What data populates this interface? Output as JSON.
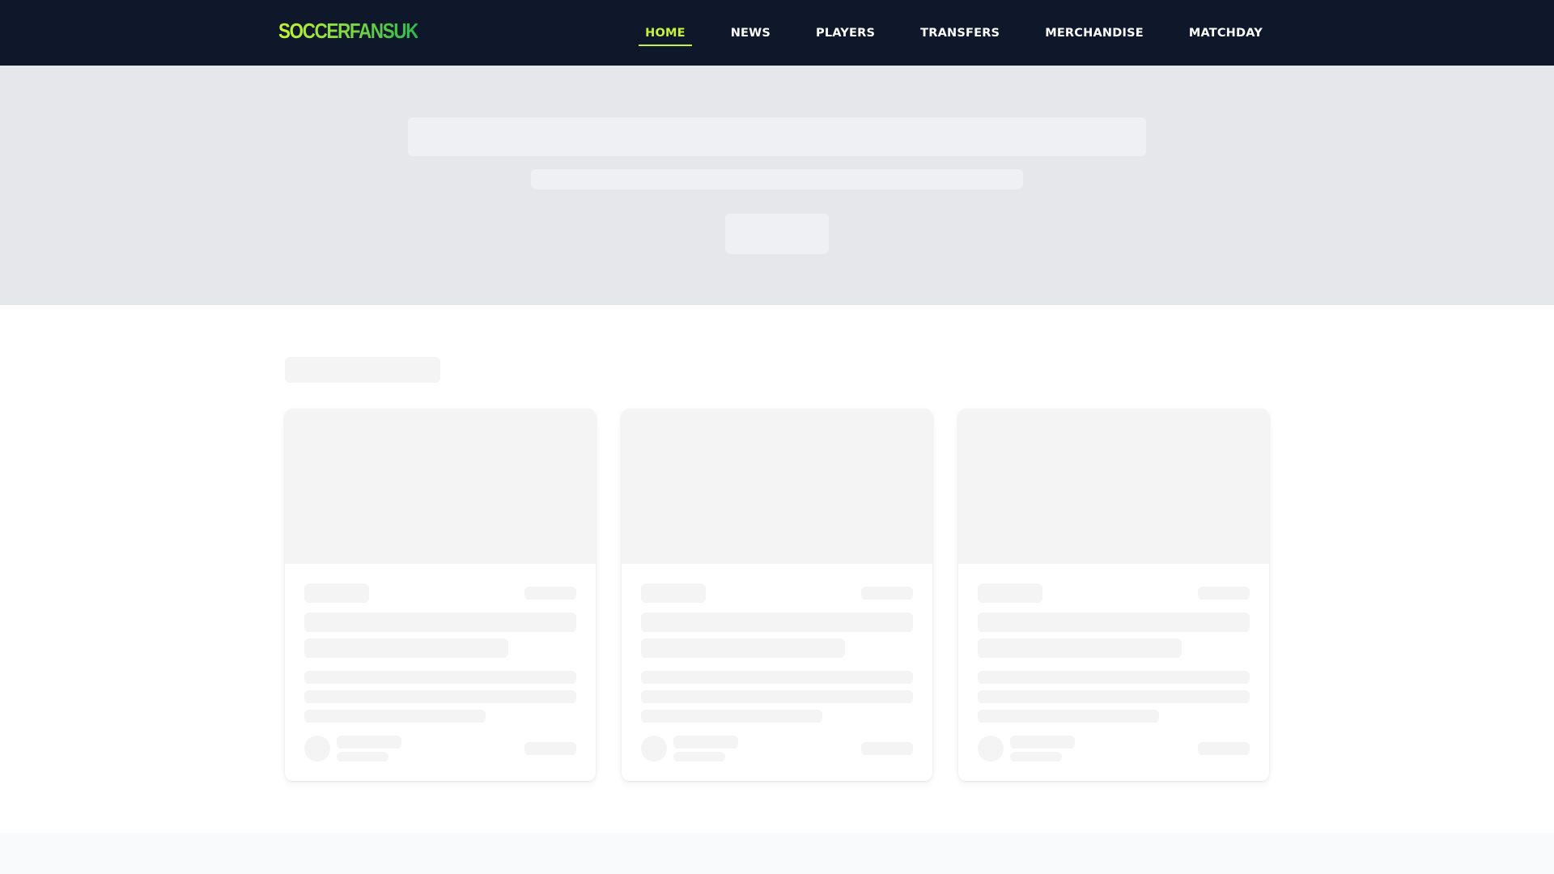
{
  "header": {
    "logo": "SOCCERFANSUK",
    "nav": [
      {
        "label": "HOME",
        "active": true
      },
      {
        "label": "NEWS",
        "active": false
      },
      {
        "label": "PLAYERS",
        "active": false
      },
      {
        "label": "TRANSFERS",
        "active": false
      },
      {
        "label": "MERCHANDISE",
        "active": false
      },
      {
        "label": "MATCHDAY",
        "active": false
      }
    ]
  },
  "colors": {
    "header_bg": "#0f172a",
    "accent": "#c6f432",
    "hero_bg": "#e5e7eb",
    "skeleton": "#f4f4f5"
  },
  "state": "loading-skeleton",
  "cards_count": 3
}
